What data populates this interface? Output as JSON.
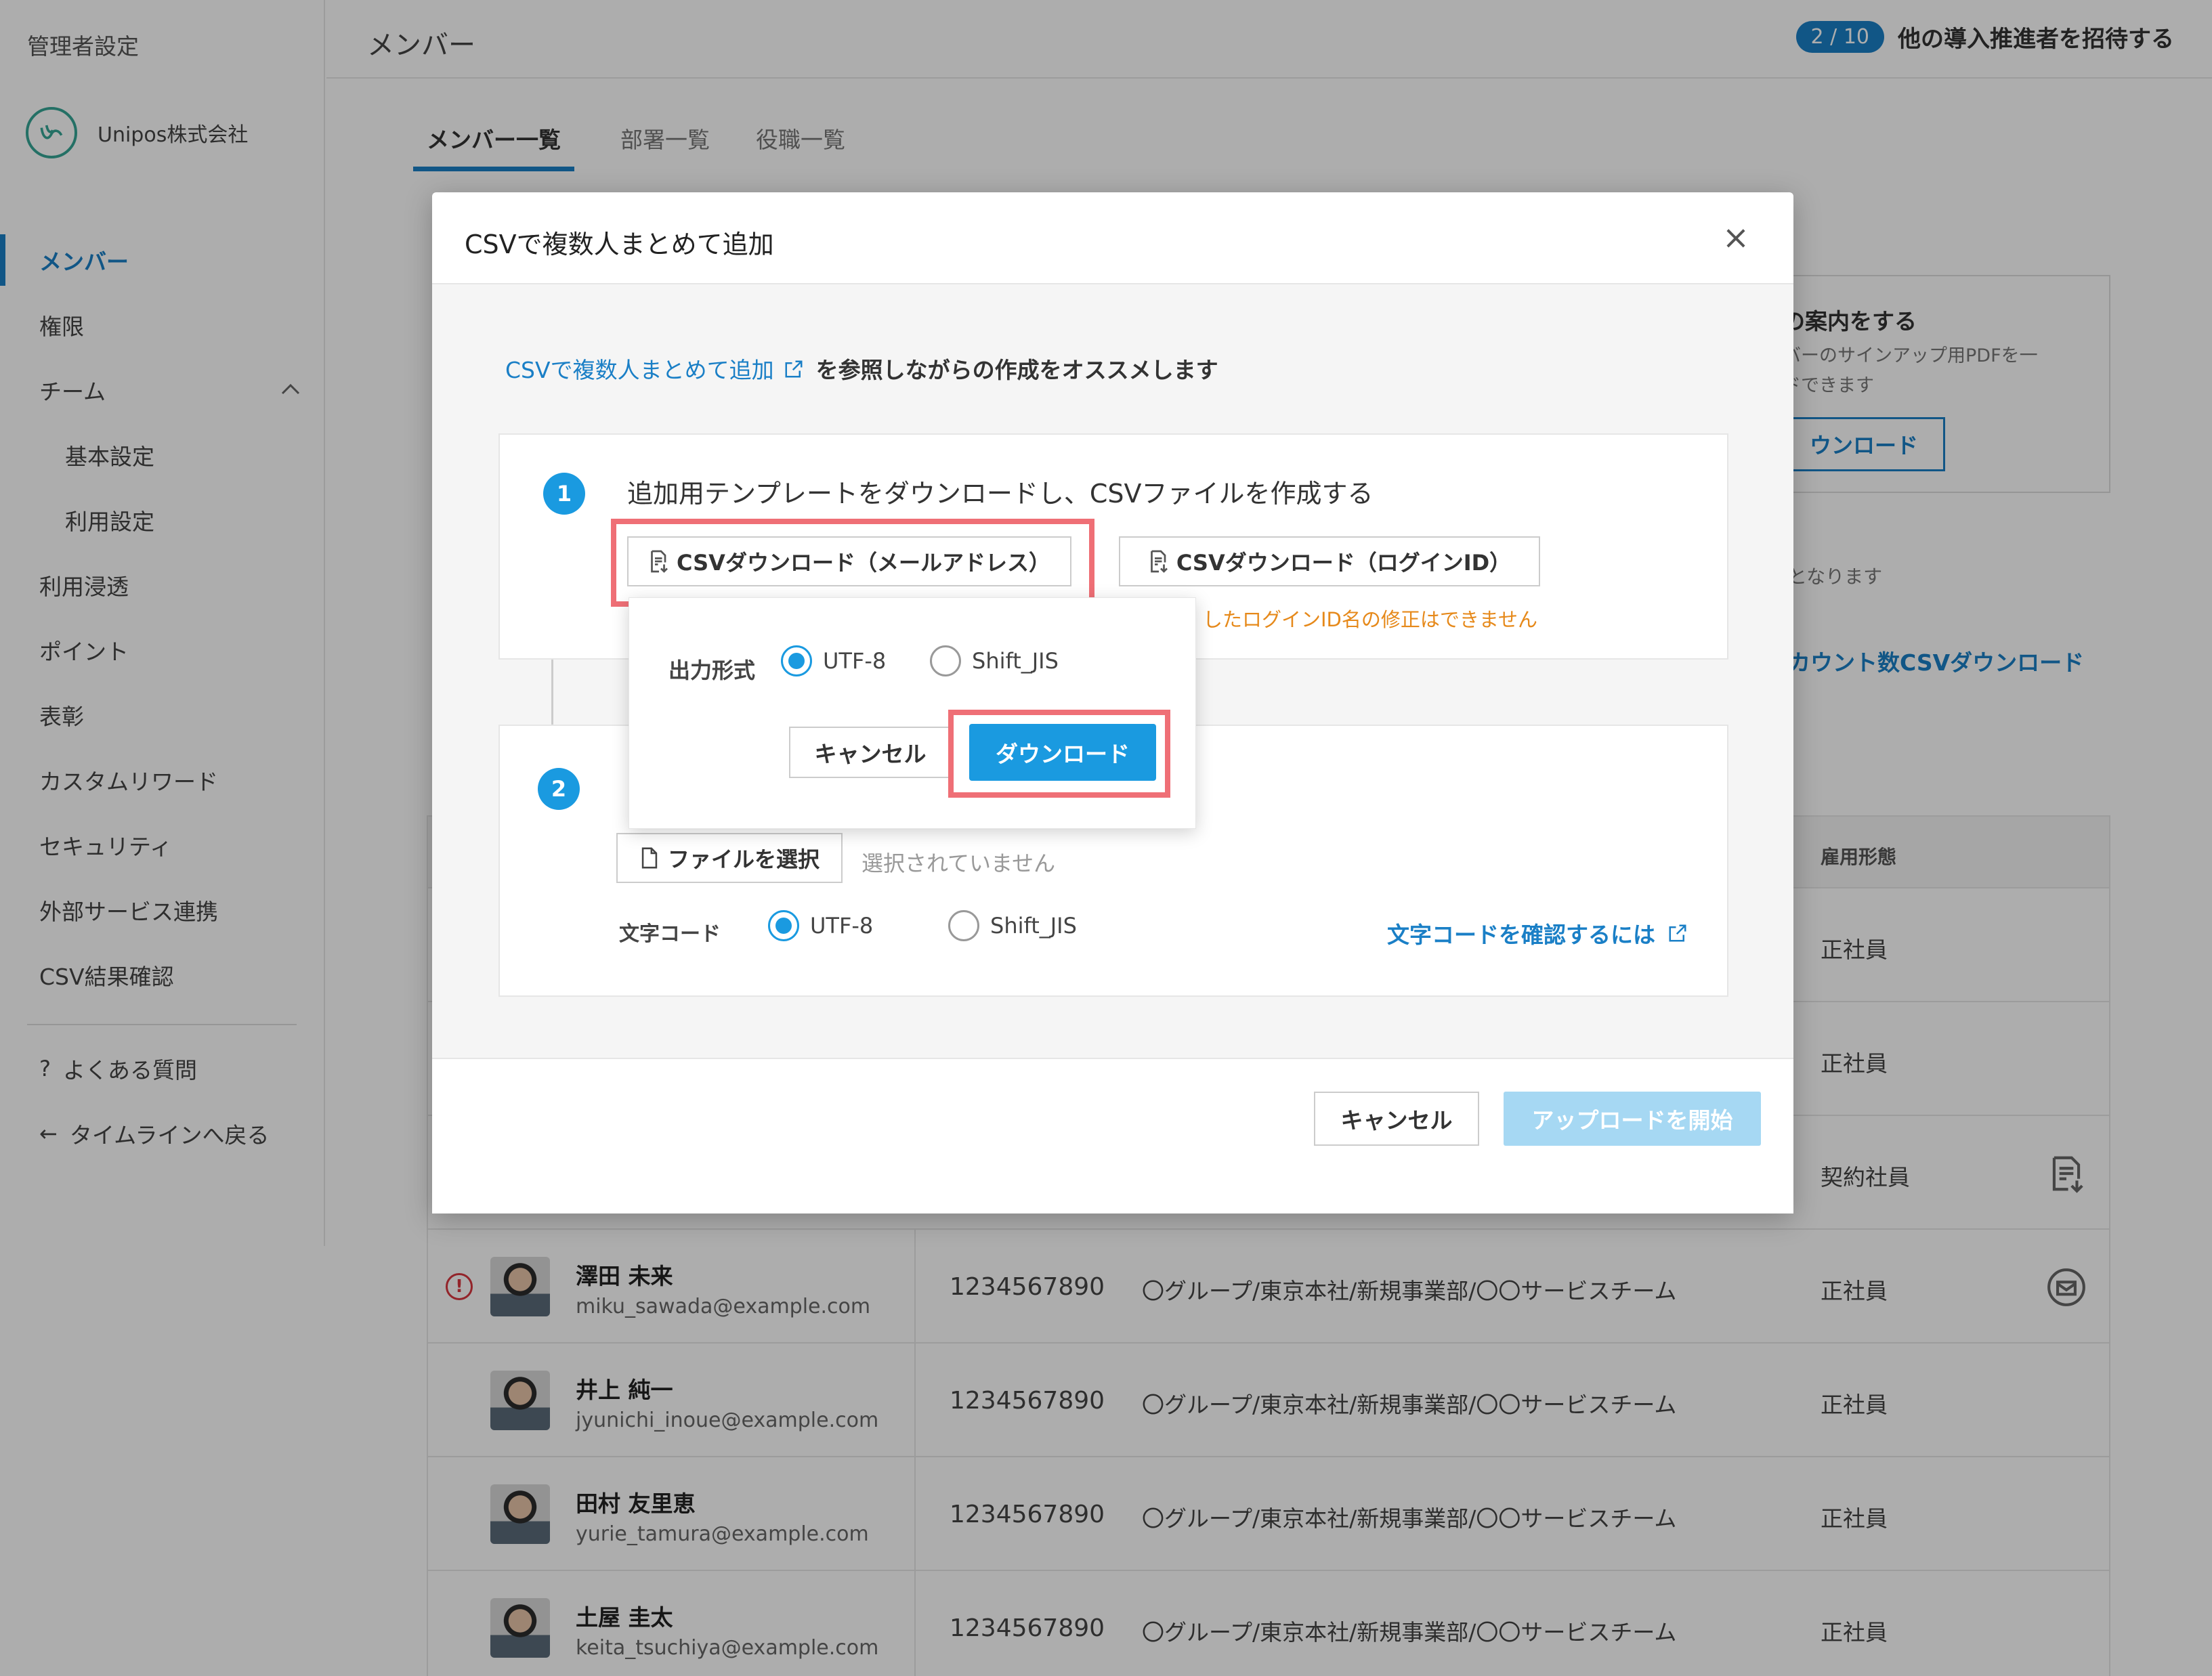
{
  "sidebar": {
    "title": "管理者設定",
    "org_name": "Unipos株式会社",
    "items": [
      {
        "label": "メンバー"
      },
      {
        "label": "権限"
      },
      {
        "label": "チーム"
      },
      {
        "label": "基本設定"
      },
      {
        "label": "利用設定"
      },
      {
        "label": "利用浸透"
      },
      {
        "label": "ポイント"
      },
      {
        "label": "表彰"
      },
      {
        "label": "カスタムリワード"
      },
      {
        "label": "セキュリティ"
      },
      {
        "label": "外部サービス連携"
      },
      {
        "label": "CSV結果確認"
      }
    ],
    "faq_icon": "?",
    "faq": "よくある質問",
    "back_icon": "←",
    "back": "タイムラインへ戻る"
  },
  "header": {
    "title": "メンバー",
    "invite_badge": "2 / 10",
    "invite_text": "他の導入推進者を招待する"
  },
  "tabs": [
    {
      "label": "メンバー一覧"
    },
    {
      "label": "部署一覧"
    },
    {
      "label": "役職一覧"
    }
  ],
  "promo": {
    "title": "の案内をする",
    "desc1": "バーのサインアップ用PDFを一",
    "desc2": "ドできます",
    "button": "ウンロード"
  },
  "background_notes": {
    "right_note": "となります",
    "account_csv": "カウント数CSVダウンロード"
  },
  "table": {
    "col_employment": "雇用形態",
    "hidden_rows": [
      {
        "type": "正社員"
      },
      {
        "type": "正社員"
      },
      {
        "type": "契約社員"
      }
    ],
    "rows": [
      {
        "name": "澤田 未来",
        "email": "miku_sawada@example.com",
        "id": "1234567890",
        "dept": "〇グループ/東京本社/新規事業部/〇〇サービスチーム",
        "type": "正社員",
        "warn": "!"
      },
      {
        "name": "井上 純一",
        "email": "jyunichi_inoue@example.com",
        "id": "1234567890",
        "dept": "〇グループ/東京本社/新規事業部/〇〇サービスチーム",
        "type": "正社員"
      },
      {
        "name": "田村 友里恵",
        "email": "yurie_tamura@example.com",
        "id": "1234567890",
        "dept": "〇グループ/東京本社/新規事業部/〇〇サービスチーム",
        "type": "正社員"
      },
      {
        "name": "土屋 圭太",
        "email": "keita_tsuchiya@example.com",
        "id": "1234567890",
        "dept": "〇グループ/東京本社/新規事業部/〇〇サービスチーム",
        "type": "正社員"
      }
    ]
  },
  "modal": {
    "title": "CSVで複数人まとめて追加",
    "close_icon": "×",
    "intro_link": "CSVで複数人まとめて追加",
    "intro_rest": "を参照しながらの作成をオススメします",
    "step1": {
      "num": "1",
      "title": "追加用テンプレートをダウンロードし、CSVファイルを作成する",
      "btn_mail": "CSVダウンロード（メールアドレス）",
      "btn_login": "CSVダウンロード（ログインID）",
      "warning": "したログインID名の修正はできません"
    },
    "step2": {
      "num": "2",
      "file_button": "ファイルを選択",
      "file_status": "選択されていません",
      "encoding_label": "文字コード",
      "enc_utf8": "UTF-8",
      "enc_sjis": "Shift_JIS",
      "encoding_help": "文字コードを確認するには"
    },
    "popover": {
      "label": "出力形式",
      "opt_utf8": "UTF-8",
      "opt_sjis": "Shift_JIS",
      "cancel": "キャンセル",
      "download": "ダウンロード"
    },
    "footer": {
      "cancel": "キャンセル",
      "upload": "アップロードを開始"
    }
  },
  "colors": {
    "accent": "#1a7fc6",
    "primary_button": "#1a9ae0",
    "highlight": "#ef6f76",
    "warning": "#e6891a"
  }
}
